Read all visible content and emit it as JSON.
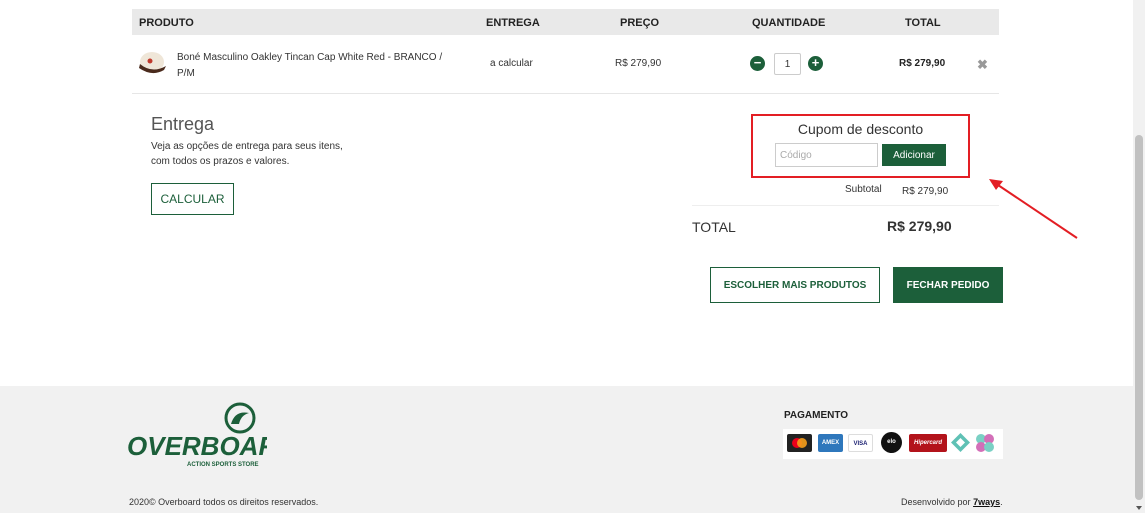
{
  "table": {
    "headers": {
      "produto": "PRODUTO",
      "entrega": "ENTREGA",
      "preco": "PREÇO",
      "quantidade": "QUANTIDADE",
      "total": "TOTAL"
    },
    "items": [
      {
        "name": "Boné Masculino Oakley Tincan Cap White Red - BRANCO / P/M",
        "entrega": "a calcular",
        "preco": "R$ 279,90",
        "quantidade": "1",
        "total": "R$ 279,90"
      }
    ]
  },
  "entrega": {
    "title": "Entrega",
    "description": "Veja as opções de entrega para seus itens, com todos os prazos e valores.",
    "button": "CALCULAR"
  },
  "cupom": {
    "title": "Cupom de desconto",
    "placeholder": "Código",
    "button": "Adicionar"
  },
  "summary": {
    "subtotal_label": "Subtotal",
    "subtotal_value": "R$ 279,90",
    "total_label": "TOTAL",
    "total_value": "R$ 279,90"
  },
  "actions": {
    "more_products": "ESCOLHER MAIS PRODUTOS",
    "close_order": "FECHAR PEDIDO"
  },
  "footer": {
    "brand": "OVERBOARD",
    "tagline": "ACTION SPORTS STORE",
    "payment_title": "PAGAMENTO",
    "payment_methods": [
      "mastercard-icon",
      "amex-icon",
      "visa-icon",
      "elo-icon",
      "hipercard-icon",
      "boleto-icon",
      "pix-icon"
    ],
    "copyright": "2020© Overboard todos os direitos reservados.",
    "developed_by": "Desenvolvido por",
    "developer": "7ways"
  },
  "colors": {
    "brand_green": "#1c5f3a",
    "highlight_red": "#e31e24"
  }
}
